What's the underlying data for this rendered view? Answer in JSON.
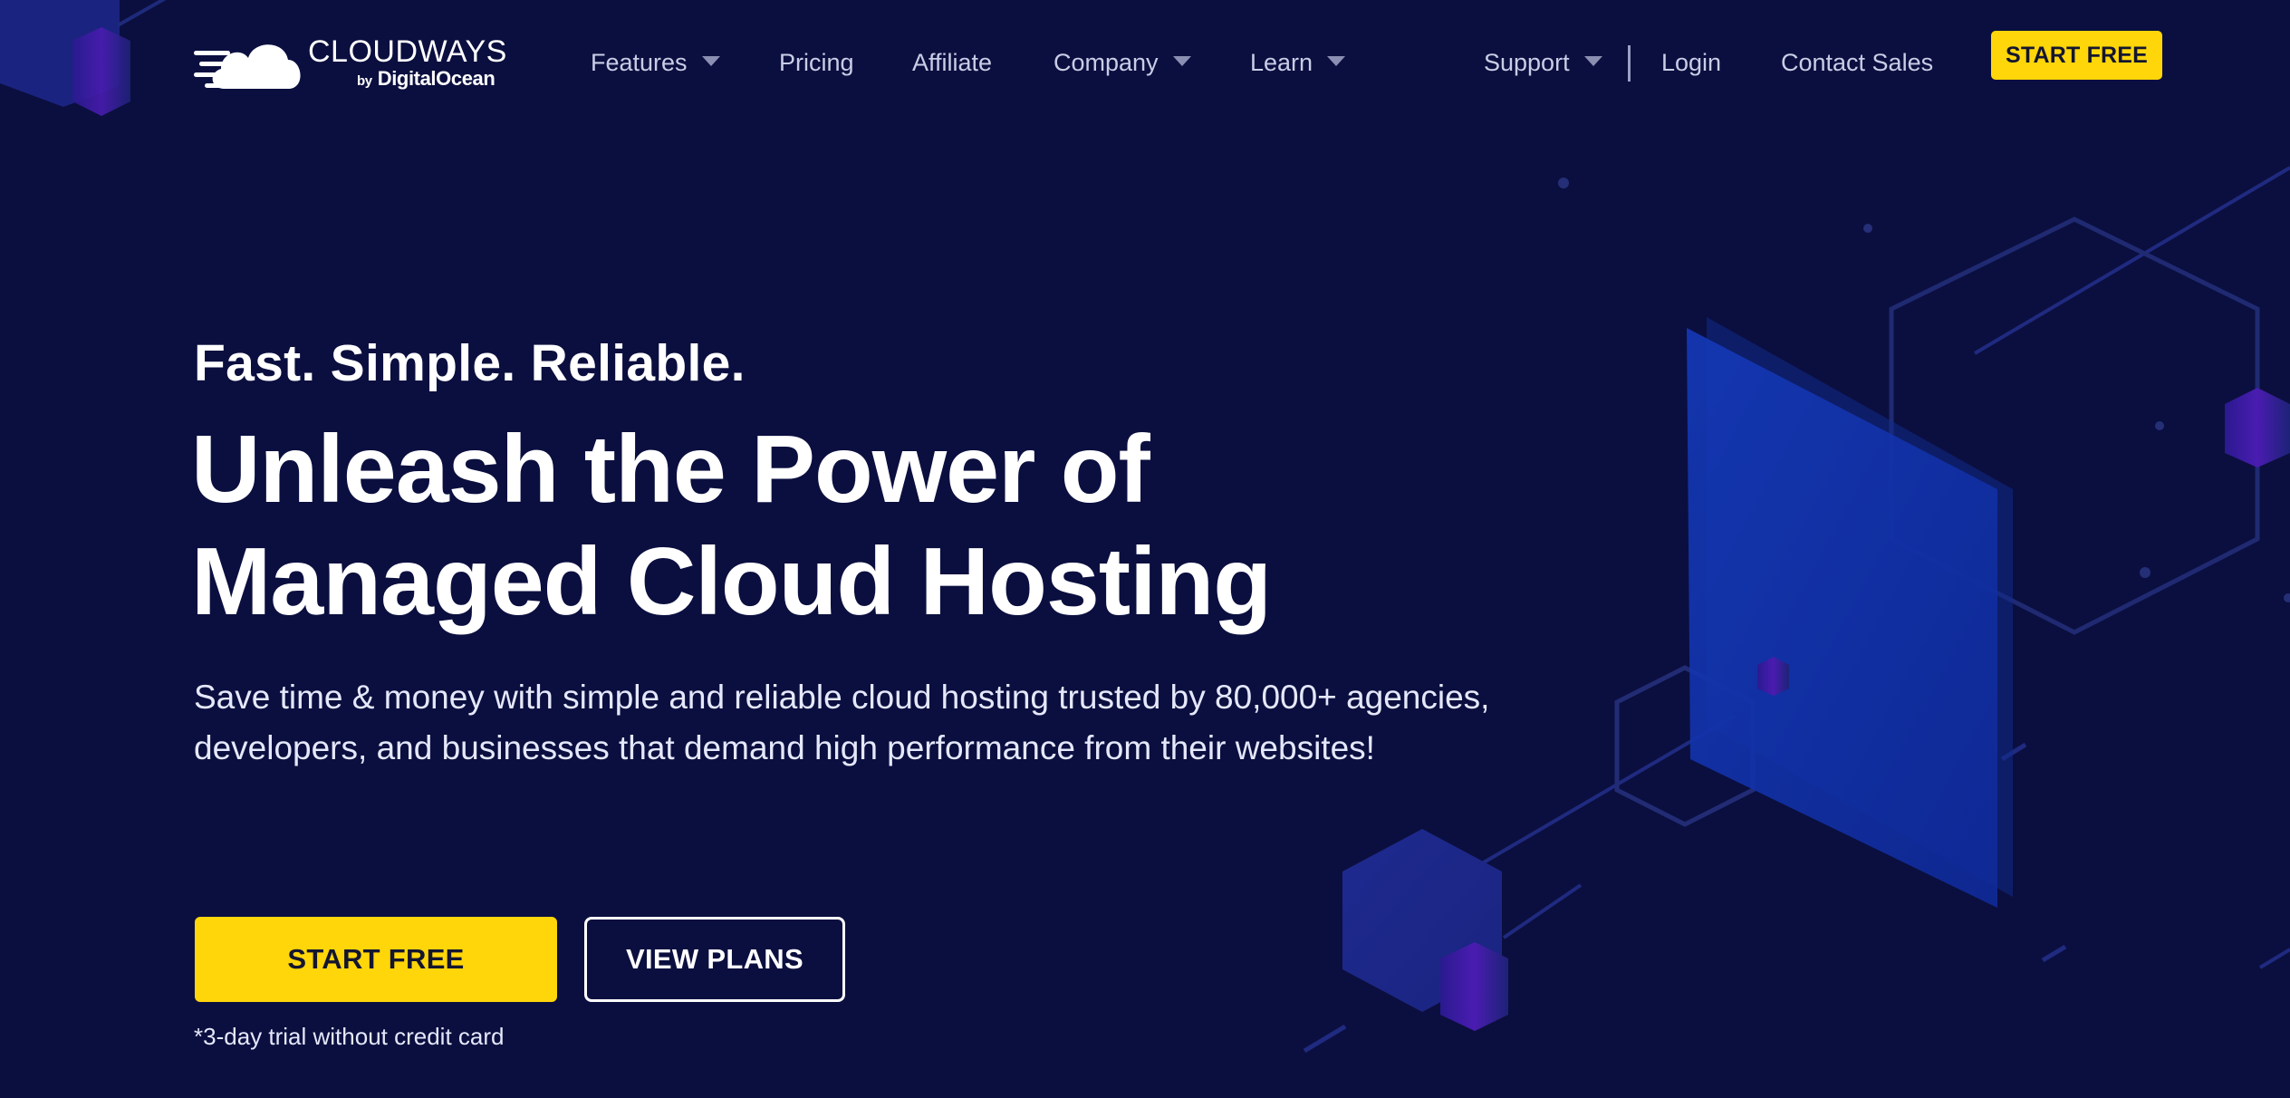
{
  "header": {
    "logo": {
      "main": "CLOUDWAYS",
      "by": "by",
      "sub": "DigitalOcean"
    },
    "nav": [
      {
        "label": "Features",
        "dropdown": true
      },
      {
        "label": "Pricing",
        "dropdown": false
      },
      {
        "label": "Affiliate",
        "dropdown": false
      },
      {
        "label": "Company",
        "dropdown": true
      },
      {
        "label": "Learn",
        "dropdown": true
      },
      {
        "label": "Support",
        "dropdown": true
      },
      {
        "label": "Login",
        "dropdown": false
      },
      {
        "label": "Contact Sales",
        "dropdown": false
      }
    ],
    "cta_label": "START FREE"
  },
  "hero": {
    "tagline": "Fast. Simple. Reliable.",
    "title_line_1": "Unleash the Power of",
    "title_line_2": "Managed Cloud Hosting",
    "description": "Save time & money with simple and reliable cloud hosting trusted by 80,000+ agencies, developers, and businesses that demand high performance from their websites!",
    "primary_cta": "START FREE",
    "secondary_cta": "VIEW PLANS",
    "trial_note": "*3-day trial without credit card"
  },
  "colors": {
    "background": "#0b0f3f",
    "accent": "#ffd60a",
    "text": "#ffffff"
  },
  "icons": {
    "logo_mark": "cloud-speed-icon",
    "dropdown": "caret-down-icon"
  }
}
